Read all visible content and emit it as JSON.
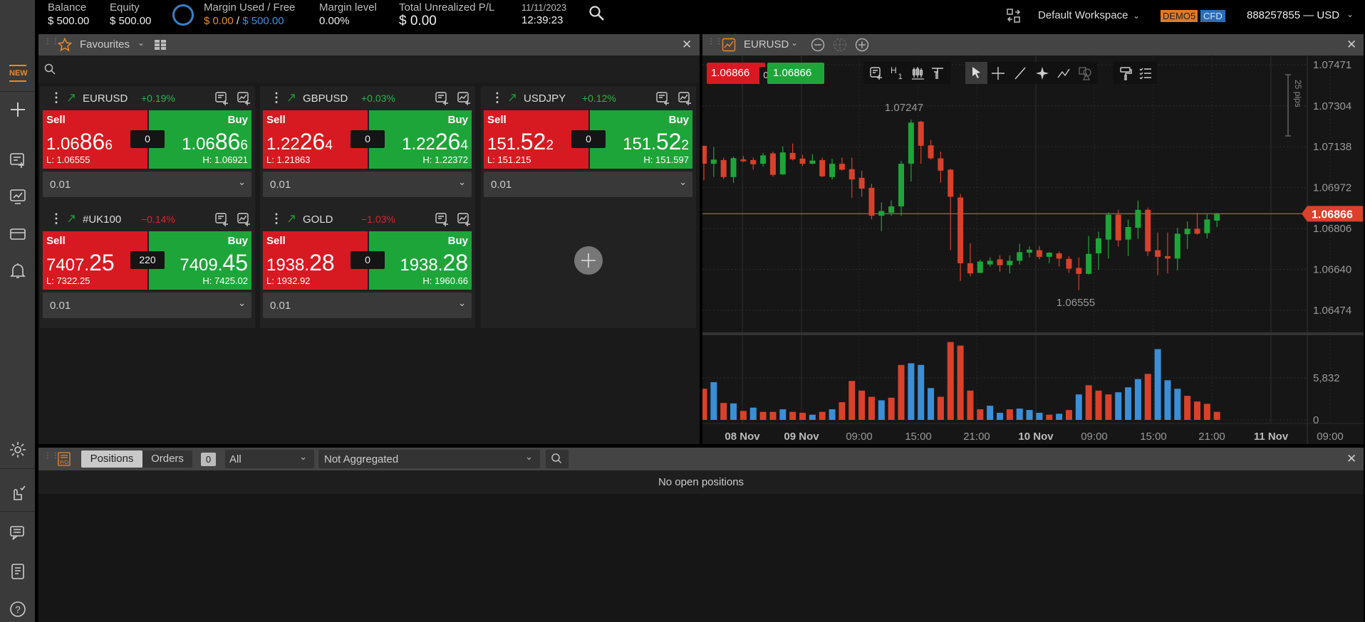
{
  "topbar": {
    "balance_label": "Balance",
    "balance_value": "$ 500.00",
    "equity_label": "Equity",
    "equity_value": "$ 500.00",
    "margin_label": "Margin Used / Free",
    "margin_used": "$ 0.00",
    "margin_sep": " / ",
    "margin_free": "$ 500.00",
    "margin_level_label": "Margin level",
    "margin_level_value": "0.00%",
    "pl_label": "Total Unrealized P/L",
    "pl_value": "$ 0.00",
    "date": "11/11/2023",
    "time": "12:39:23",
    "workspace": "Default Workspace",
    "demo_badge": "DEMO5",
    "cfd_badge": "CFD",
    "account": "888257855 — USD"
  },
  "sidebar": {
    "new_badge": "NEW"
  },
  "favourites": {
    "title": "Favourites",
    "tiles": [
      {
        "symbol": "EURUSD",
        "change": "+0.19%",
        "dir": "up",
        "sell_label": "Sell",
        "buy_label": "Buy",
        "sell": {
          "a": "1.06",
          "b": "86",
          "c": "6"
        },
        "buy": {
          "a": "1.06",
          "b": "86",
          "c": "6"
        },
        "spread": "0",
        "low": "L: 1.06555",
        "high": "H: 1.06921",
        "quantity": "0.01"
      },
      {
        "symbol": "GBPUSD",
        "change": "+0.03%",
        "dir": "up",
        "sell_label": "Sell",
        "buy_label": "Buy",
        "sell": {
          "a": "1.22",
          "b": "26",
          "c": "4"
        },
        "buy": {
          "a": "1.22",
          "b": "26",
          "c": "4"
        },
        "spread": "0",
        "low": "L: 1.21863",
        "high": "H: 1.22372",
        "quantity": "0.01"
      },
      {
        "symbol": "USDJPY",
        "change": "+0.12%",
        "dir": "up",
        "sell_label": "Sell",
        "buy_label": "Buy",
        "sell": {
          "a": "151.",
          "b": "52",
          "c": "2"
        },
        "buy": {
          "a": "151.",
          "b": "52",
          "c": "2"
        },
        "spread": "0",
        "low": "L: 151.215",
        "high": "H: 151.597",
        "quantity": "0.01"
      },
      {
        "symbol": "#UK100",
        "change": "−0.14%",
        "dir": "down",
        "sell_label": "Sell",
        "buy_label": "Buy",
        "sell": {
          "a": "7407.",
          "b": "25",
          "c": ""
        },
        "buy": {
          "a": "7409.",
          "b": "45",
          "c": ""
        },
        "spread": "220",
        "low": "L: 7322.25",
        "high": "H: 7425.02",
        "quantity": "0.01"
      },
      {
        "symbol": "GOLD",
        "change": "−1.03%",
        "dir": "down",
        "sell_label": "Sell",
        "buy_label": "Buy",
        "sell": {
          "a": "1938.",
          "b": "28",
          "c": ""
        },
        "buy": {
          "a": "1938.",
          "b": "28",
          "c": ""
        },
        "spread": "0",
        "low": "L: 1932.92",
        "high": "H: 1960.66",
        "quantity": "0.01"
      }
    ]
  },
  "chart_panel": {
    "symbol": "EURUSD",
    "bid": "1.06866",
    "ask": "1.06866",
    "spread": "0",
    "tf_letter": "H",
    "tf_num": "1"
  },
  "chart_data": {
    "type": "candlestick",
    "y_ticks": [
      "1.07471",
      "1.07304",
      "1.07138",
      "1.06972",
      "1.06806",
      "1.06640",
      "1.06474"
    ],
    "ylim": [
      1.06474,
      1.07471
    ],
    "x_ticks": [
      "08 Nov",
      "09 Nov",
      "09:00",
      "15:00",
      "21:00",
      "10 Nov",
      "09:00",
      "15:00",
      "21:00",
      "11 Nov",
      "09:00"
    ],
    "x_ticks_bold": [
      true,
      true,
      false,
      false,
      false,
      true,
      false,
      false,
      false,
      true,
      false
    ],
    "last_price": 1.06866,
    "last_price_label": "1.06866",
    "high_label": "1.07247",
    "low_label": "1.06555",
    "ruler_label": "25 pips",
    "candles_ohlc": [
      [
        1.07142,
        1.07142,
        1.07002,
        1.07069
      ],
      [
        1.07069,
        1.07137,
        1.07016,
        1.07086
      ],
      [
        1.07084,
        1.07094,
        1.07007,
        1.07015
      ],
      [
        1.07015,
        1.07098,
        1.06992,
        1.07092
      ],
      [
        1.07087,
        1.07101,
        1.07076,
        1.07079
      ],
      [
        1.07084,
        1.07094,
        1.07045,
        1.07067
      ],
      [
        1.07069,
        1.07113,
        1.07057,
        1.07103
      ],
      [
        1.07111,
        1.07118,
        1.07016,
        1.07024
      ],
      [
        1.07026,
        1.0714,
        1.07024,
        1.07115
      ],
      [
        1.07113,
        1.07151,
        1.07082,
        1.07087
      ],
      [
        1.0709,
        1.07105,
        1.0706,
        1.07069
      ],
      [
        1.07069,
        1.07108,
        1.07067,
        1.07082
      ],
      [
        1.07084,
        1.07094,
        1.07015,
        1.07018
      ],
      [
        1.07015,
        1.07089,
        1.07005,
        1.07069
      ],
      [
        1.07069,
        1.07094,
        1.07041,
        1.07045
      ],
      [
        1.07047,
        1.07094,
        1.0693,
        1.07005
      ],
      [
        1.07012,
        1.07041,
        1.06935,
        1.06968
      ],
      [
        1.06971,
        1.06988,
        1.06843,
        1.06858
      ],
      [
        1.06858,
        1.06912,
        1.06795,
        1.06877
      ],
      [
        1.0687,
        1.0692,
        1.06858,
        1.06896
      ],
      [
        1.06896,
        1.07081,
        1.06858,
        1.07069
      ],
      [
        1.07069,
        1.07248,
        1.06997,
        1.07236
      ],
      [
        1.0724,
        1.07243,
        1.07069,
        1.07142
      ],
      [
        1.07144,
        1.07166,
        1.07086,
        1.07091
      ],
      [
        1.07091,
        1.07118,
        1.06992,
        1.07041
      ],
      [
        1.07045,
        1.07048,
        1.06718,
        1.06935
      ],
      [
        1.06932,
        1.06947,
        1.06593,
        1.06665
      ],
      [
        1.06665,
        1.06747,
        1.06612,
        1.06624
      ],
      [
        1.06626,
        1.06679,
        1.06624,
        1.06672
      ],
      [
        1.0666,
        1.06689,
        1.06651,
        1.06675
      ],
      [
        1.06681,
        1.06697,
        1.06631,
        1.06657
      ],
      [
        1.06657,
        1.06697,
        1.06624,
        1.06675
      ],
      [
        1.06675,
        1.06744,
        1.0666,
        1.0671
      ],
      [
        1.06708,
        1.06734,
        1.06689,
        1.0672
      ],
      [
        1.06718,
        1.06735,
        1.06681,
        1.06691
      ],
      [
        1.06691,
        1.0671,
        1.06665,
        1.06708
      ],
      [
        1.06705,
        1.06713,
        1.06652,
        1.06684
      ],
      [
        1.06683,
        1.06694,
        1.06626,
        1.06643
      ],
      [
        1.06646,
        1.06689,
        1.06556,
        1.06622
      ],
      [
        1.06622,
        1.06776,
        1.06619,
        1.06703
      ],
      [
        1.06705,
        1.06793,
        1.06638,
        1.06766
      ],
      [
        1.06761,
        1.06872,
        1.06684,
        1.06862
      ],
      [
        1.06862,
        1.06882,
        1.06732,
        1.06758
      ],
      [
        1.06761,
        1.06843,
        1.06694,
        1.06812
      ],
      [
        1.06809,
        1.0692,
        1.06764,
        1.06882
      ],
      [
        1.06882,
        1.06891,
        1.06694,
        1.06713
      ],
      [
        1.06718,
        1.0679,
        1.06617,
        1.06691
      ],
      [
        1.06694,
        1.0679,
        1.06624,
        1.06684
      ],
      [
        1.06684,
        1.06809,
        1.06636,
        1.06785
      ],
      [
        1.06783,
        1.06835,
        1.06723,
        1.06805
      ],
      [
        1.06805,
        1.0687,
        1.06781,
        1.06785
      ],
      [
        1.06787,
        1.06864,
        1.06766,
        1.06843
      ],
      [
        1.06838,
        1.0687,
        1.06812,
        1.06864
      ]
    ],
    "volume": {
      "ticks": [
        "5,832",
        "0"
      ],
      "tick_values": [
        5832,
        0
      ],
      "values": [
        4324,
        5242,
        2359,
        2290,
        1245,
        1704,
        1114,
        1114,
        1474,
        1114,
        983,
        721,
        1114,
        1474,
        2457,
        5405,
        4062,
        3210,
        2719,
        3079,
        7633,
        7862,
        7633,
        4423,
        3210,
        10811,
        10319,
        4062,
        1474,
        1966,
        983,
        1474,
        1572,
        1376,
        983,
        721,
        852,
        1376,
        3538,
        4816,
        4062,
        3538,
        3833,
        4521,
        5667,
        6388,
        9828,
        5504,
        4324,
        3342,
        2555,
        2228,
        1114
      ],
      "dir": "dudududduddududdddudduuuddddduuduuudududdduuuduuudddduuduu"
    }
  },
  "positions": {
    "tabs": [
      "Positions",
      "Orders"
    ],
    "count": "0",
    "filter": "All",
    "aggregation": "Not Aggregated",
    "empty": "No open positions"
  },
  "colors": {
    "sell": "#d71a21",
    "buy": "#1ea539",
    "bull": "#1ea539",
    "bear": "#d9412b",
    "vol_up": "#3a8fd6",
    "vol_down": "#d9412b",
    "accent": "#e8892b",
    "price_line": "#8a7050"
  }
}
